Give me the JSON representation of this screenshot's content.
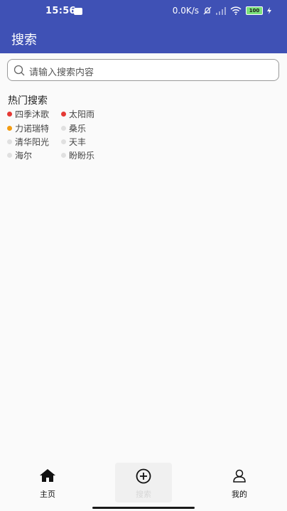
{
  "status_bar": {
    "time": "15:56",
    "net_speed": "0.0K/s",
    "battery": "100"
  },
  "app_bar": {
    "title": "搜索"
  },
  "search": {
    "placeholder": "请输入搜索内容"
  },
  "hot": {
    "title": "热门搜索",
    "items": [
      {
        "label": "四季沐歌",
        "dot_color": "#e53935"
      },
      {
        "label": "太阳雨",
        "dot_color": "#e53935"
      },
      {
        "label": "力诺瑞特",
        "dot_color": "#f39c12"
      },
      {
        "label": "桑乐",
        "dot_color": "#e0e0e0"
      },
      {
        "label": "清华阳光",
        "dot_color": "#e0e0e0"
      },
      {
        "label": "天丰",
        "dot_color": "#e0e0e0"
      },
      {
        "label": "海尔",
        "dot_color": "#e0e0e0"
      },
      {
        "label": "盼盼乐",
        "dot_color": "#e0e0e0"
      }
    ]
  },
  "bottom_nav": {
    "items": [
      {
        "label": "主页",
        "icon": "home-icon"
      },
      {
        "label": "搜索",
        "icon": "add-circle-icon"
      },
      {
        "label": "我的",
        "icon": "person-icon"
      }
    ]
  },
  "colors": {
    "primary": "#3f51b5",
    "background": "#fafafa"
  }
}
